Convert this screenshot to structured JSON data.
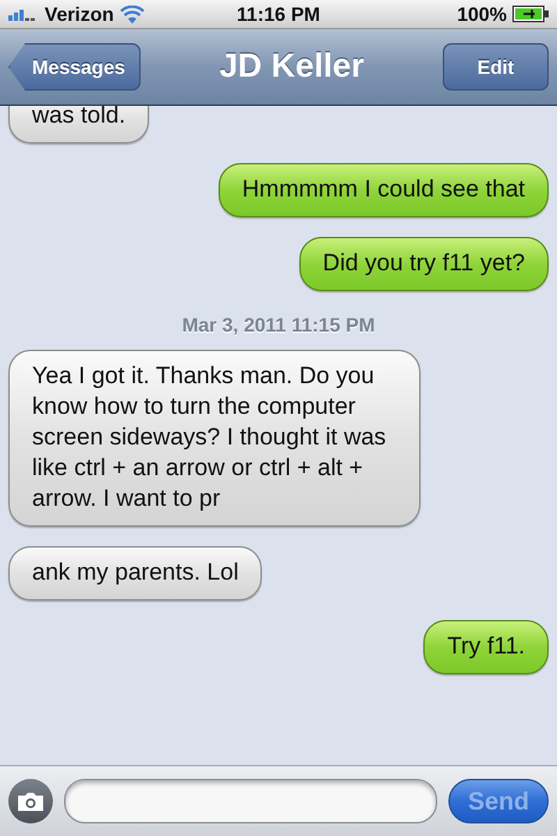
{
  "status_bar": {
    "carrier": "Verizon",
    "time": "11:16 PM",
    "battery": "100%"
  },
  "nav": {
    "back": "Messages",
    "title": "JD Keller",
    "edit": "Edit"
  },
  "messages": [
    {
      "kind": "received",
      "text": "was told."
    },
    {
      "kind": "sent",
      "text": "Hmmmmm I could see that"
    },
    {
      "kind": "sent",
      "text": "Did you try f11 yet?"
    },
    {
      "kind": "timestamp",
      "text": "Mar 3, 2011 11:15 PM"
    },
    {
      "kind": "received",
      "text": "Yea I got it. Thanks man. Do you know how to turn the computer screen sideways? I thought it was like ctrl + an arrow or ctrl + alt + arrow. I want to pr"
    },
    {
      "kind": "received",
      "text": "ank my parents. Lol"
    },
    {
      "kind": "sent",
      "text": "Try f11."
    }
  ],
  "composer": {
    "send": "Send",
    "send_disabled": true
  }
}
